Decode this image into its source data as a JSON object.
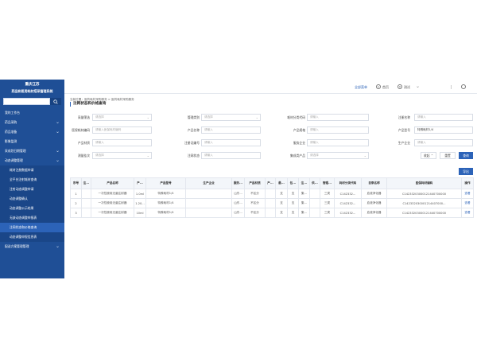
{
  "brand": {
    "line1": "重庆江苏",
    "line2": "药品和医用耗材招采管理系统"
  },
  "sidebar": {
    "items": [
      {
        "label": "我的工作台",
        "chevron": false,
        "level": 1
      },
      {
        "label": "药品采购",
        "chevron": true,
        "level": 1
      },
      {
        "label": "药品准备",
        "chevron": true,
        "level": 1
      },
      {
        "label": "影像监测",
        "chevron": false,
        "level": 1
      },
      {
        "label": "采成划日期管理",
        "chevron": true,
        "level": 1
      },
      {
        "label": "动态调整管理",
        "chevron": true,
        "level": 1
      },
      {
        "label": "耗材注册数据申请",
        "chevron": false,
        "level": 2
      },
      {
        "label": "全平台注射耗材查询",
        "chevron": false,
        "level": 2
      },
      {
        "label": "注射动态调整申请",
        "chevron": false,
        "level": 2
      },
      {
        "label": "动态调整确认",
        "chevron": false,
        "level": 2
      },
      {
        "label": "动态调整公示结果",
        "chevron": false,
        "level": 2
      },
      {
        "label": "无缺动态调整申报表",
        "chevron": false,
        "level": 2
      },
      {
        "label": "注网状态和价格查询",
        "chevron": false,
        "level": 2,
        "active": true
      },
      {
        "label": "动态调整申报信息表",
        "chevron": false,
        "level": 2
      },
      {
        "label": "配送方案管理管理",
        "chevron": true,
        "level": 1
      }
    ]
  },
  "topbar": {
    "link": "全部菜单",
    "home": "首页",
    "user": "测试",
    "home_icon": "A",
    "user_icon": "R"
  },
  "breadcrumb": "当前位置：医药耗材采购服务 > 医药耗材采购服务",
  "page_title": "注网状态和价格查询",
  "filters": {
    "row1": [
      {
        "label": "采量筛选",
        "placeholder": "请选择",
        "dropdown": true
      },
      {
        "label": "管理类别",
        "placeholder": "请选择",
        "dropdown": true
      },
      {
        "label": "耗材分类代码",
        "placeholder": "请输入",
        "dropdown": false
      },
      {
        "label": "注册名称",
        "placeholder": "请输入",
        "dropdown": false
      }
    ],
    "row2": [
      {
        "label": "医保耗材编码",
        "placeholder": "请输入医保耗材编码",
        "dropdown": false
      },
      {
        "label": "产品名称",
        "placeholder": "请输入",
        "dropdown": false
      },
      {
        "label": "产品规格",
        "placeholder": "请输入",
        "dropdown": false
      },
      {
        "label": "产品型号",
        "placeholder": "特殊耗材1/4",
        "dropdown": false,
        "filled": true
      }
    ],
    "row3": [
      {
        "label": "产品材质",
        "placeholder": "请输入",
        "dropdown": false
      },
      {
        "label": "注册证编号",
        "placeholder": "请输入",
        "dropdown": false
      },
      {
        "label": "服务企业",
        "placeholder": "请输入",
        "dropdown": false
      },
      {
        "label": "生产企业",
        "placeholder": "请输入",
        "dropdown": false
      }
    ],
    "row4": [
      {
        "label": "测量挂次",
        "placeholder": "请选择",
        "dropdown": true
      },
      {
        "label": "注网状态",
        "placeholder": "请输入",
        "dropdown": false
      },
      {
        "label": "集成类产品",
        "placeholder": "请选择",
        "dropdown": true
      }
    ]
  },
  "actions": {
    "collapse": "收起",
    "reset": "重置",
    "query": "查询",
    "export": "导出"
  },
  "table": {
    "columns": [
      "序号",
      "注...",
      "产品名称",
      "产...",
      "产品型号",
      "生产企业",
      "服药...",
      "产品材质",
      "产...",
      "最...",
      "包...",
      "注...",
      "供...",
      "管理...",
      "耗材分类代码",
      "目录名称",
      "医保耗材编码",
      "操作"
    ],
    "rows": [
      [
        "1",
        "",
        "一次性使用无菌注射器",
        "1.0ml",
        "特殊耗材1/4",
        "",
        "山东...",
        "不区分",
        "",
        "支",
        "支",
        "集...",
        "",
        "三类",
        "C142332...",
        "血液净化器",
        "C14233203000121440700000",
        "查看"
      ],
      [
        "2",
        "",
        "一次性使用无菌注射器",
        "1.20...",
        "特殊耗材1/4",
        "",
        "山东...",
        "不区分",
        "",
        "支",
        "支",
        "集...",
        "",
        "三类",
        "C142332...",
        "血液净化器",
        "C142332030001214407000...",
        "查看"
      ],
      [
        "3",
        "",
        "一次性使用无菌注射器",
        "10ml",
        "特殊耗材1/4",
        "",
        "山东...",
        "不区分",
        "",
        "支",
        "支",
        "集...",
        "",
        "三类",
        "C142332...",
        "血液净化器",
        "C14233203000121440700000",
        "查看"
      ]
    ]
  },
  "colors": {
    "sidebar": "#1f4f96",
    "accent": "#2c63b8"
  }
}
